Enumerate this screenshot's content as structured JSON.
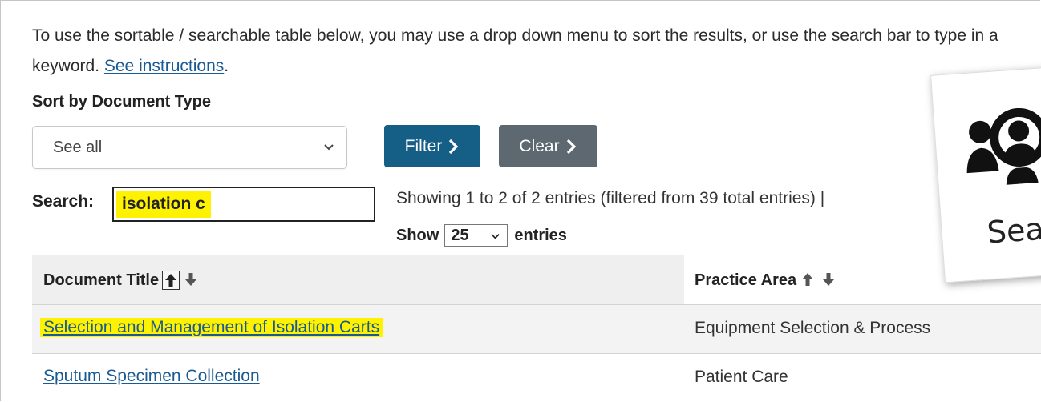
{
  "intro": {
    "text": "To use the sortable / searchable table below, you may use a drop down menu to sort the results, or use the search bar to type in a keyword.",
    "link_text": "See instructions",
    "period": "."
  },
  "sort": {
    "label": "Sort by Document Type",
    "selected": "See all"
  },
  "buttons": {
    "filter": "Filter",
    "clear": "Clear"
  },
  "search": {
    "label": "Search:",
    "value": "isolation c"
  },
  "info": {
    "showing": "Showing 1 to 2 of 2 entries (filtered from 39 total entries) |",
    "show_label": "Show",
    "page_size": "25",
    "entries_label": "entries"
  },
  "table": {
    "headers": [
      "Document Title",
      "Practice Area"
    ],
    "rows": [
      {
        "title": "Selection and Management of Isolation Carts",
        "area": "Equipment Selection & Process"
      },
      {
        "title": "Sputum Specimen Collection",
        "area": "Patient Care"
      }
    ]
  },
  "popup": {
    "text": "Sear",
    "icon": "search-people-icon"
  },
  "colors": {
    "filter_button": "#155e85",
    "clear_button": "#5d6870",
    "link": "#1a5a92",
    "highlight": "#fff200"
  }
}
